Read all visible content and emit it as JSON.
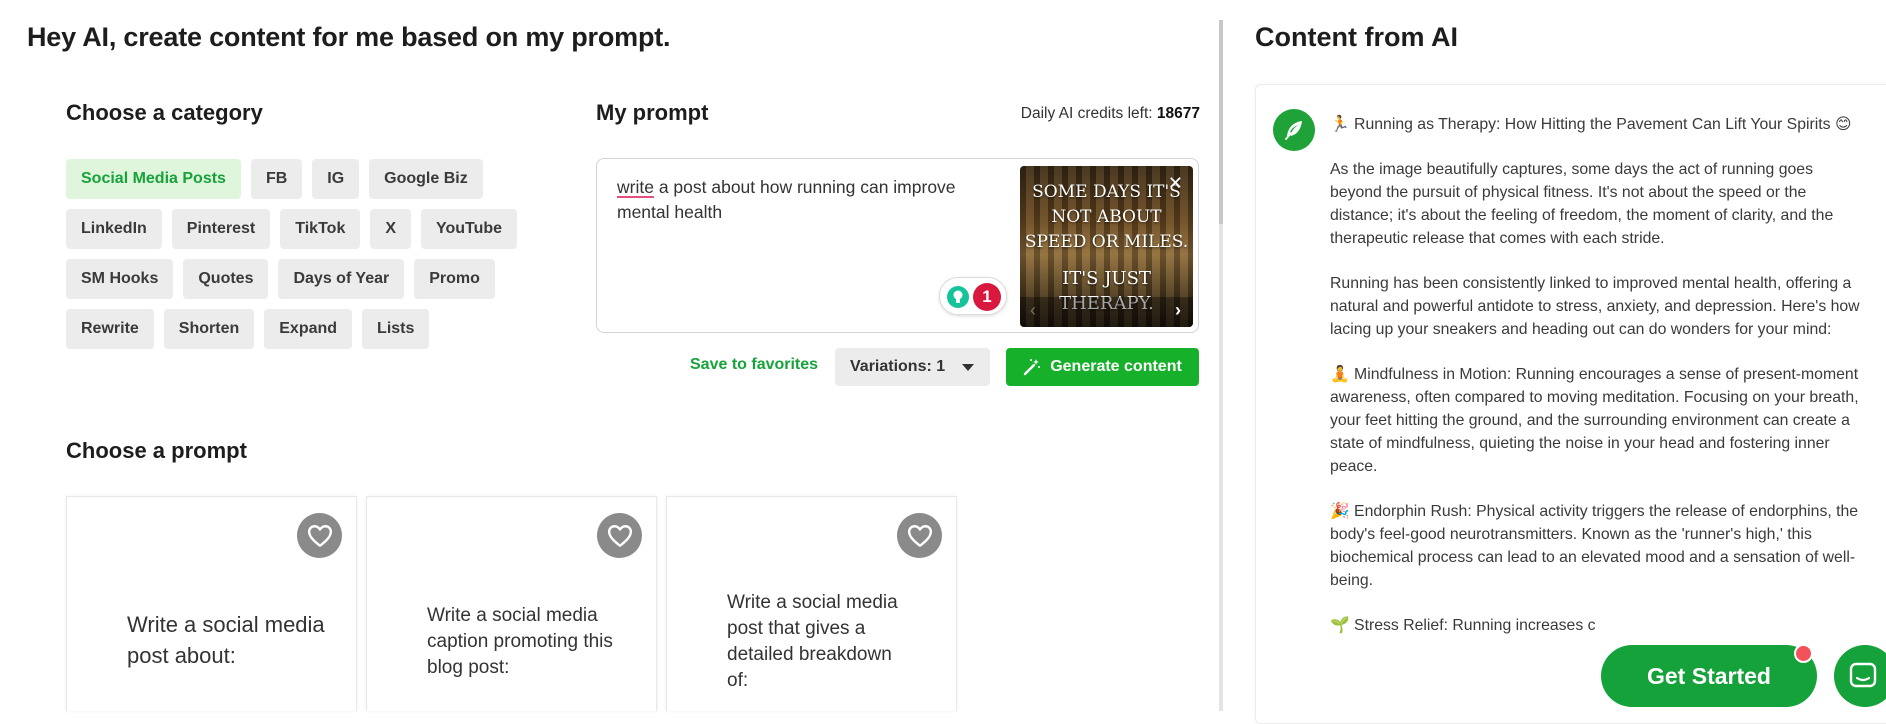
{
  "header": {
    "title": "Hey AI, create content for me based on my prompt."
  },
  "category": {
    "title": "Choose a category",
    "rows": [
      [
        "Social Media Posts",
        "FB",
        "IG",
        "Google Biz"
      ],
      [
        "LinkedIn",
        "Pinterest",
        "TikTok",
        "X",
        "YouTube"
      ],
      [
        "SM Hooks",
        "Quotes",
        "Days of Year",
        "Promo"
      ],
      [
        "Rewrite",
        "Shorten",
        "Expand",
        "Lists"
      ]
    ],
    "active": "Social Media Posts"
  },
  "prompt": {
    "title": "My prompt",
    "credits_label": "Daily AI credits left:",
    "credits_value": "18677",
    "text_first_word": "write",
    "text_rest": " a post about how running can improve mental health",
    "grammarly_count": "1",
    "image_quote_top": "SOME DAYS IT'S NOT ABOUT SPEED OR MILES.",
    "image_quote_bottom": "IT'S JUST THERAPY.",
    "save_label": "Save to favorites",
    "variations_label": "Variations: 1",
    "generate_label": "Generate content"
  },
  "choose_prompt": {
    "title": "Choose a prompt",
    "cards": [
      "Write a social media post about:",
      "Write a social media caption promoting this blog post:",
      "Write a social media post that gives a detailed breakdown of:"
    ]
  },
  "ai": {
    "title": "Content from AI",
    "paragraphs": [
      "🏃 Running as Therapy: How Hitting the Pavement Can Lift Your Spirits 😊",
      "As the image beautifully captures, some days the act of running goes beyond the pursuit of physical fitness. It's not about the speed or the distance; it's about the feeling of freedom, the moment of clarity, and the therapeutic release that comes with each stride.",
      "Running has been consistently linked to improved mental health, offering a natural and powerful antidote to stress, anxiety, and depression. Here's how lacing up your sneakers and heading out can do wonders for your mind:",
      "🧘 Mindfulness in Motion: Running encourages a sense of present-moment awareness, often compared to moving meditation. Focusing on your breath, your feet hitting the ground, and the surrounding environment can create a state of mindfulness, quieting the noise in your head and fostering inner peace.",
      "🎉 Endorphin Rush: Physical activity triggers the release of endorphins, the body's feel-good neurotransmitters. Known as the 'runner's high,' this biochemical process can lead to an elevated mood and a sensation of well-being.",
      "🌱 Stress Relief: Running increases c"
    ]
  },
  "floating": {
    "get_started": "Get Started"
  },
  "colors": {
    "accent": "#17b02a",
    "chip_active_bg": "#dff5dc",
    "chip_bg": "#ececec",
    "heart_bg": "#8a8a8a",
    "badge_red": "#d8183f"
  }
}
